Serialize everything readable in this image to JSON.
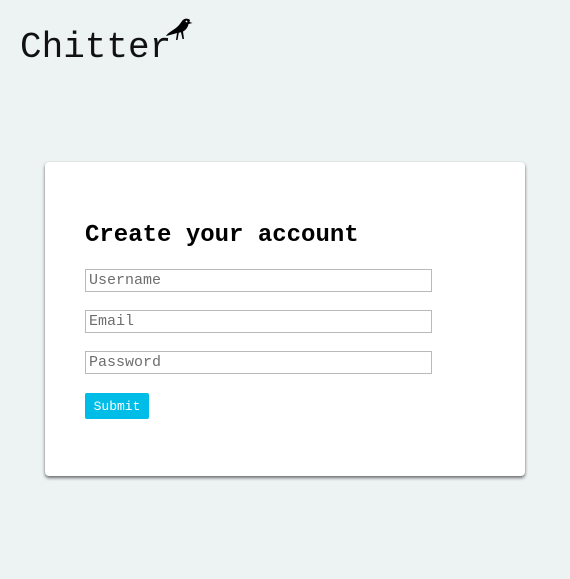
{
  "app": {
    "logo_text": "Chitter",
    "logo_icon": "bird-icon"
  },
  "signup": {
    "title": "Create your account",
    "username": {
      "placeholder": "Username",
      "value": ""
    },
    "email": {
      "placeholder": "Email",
      "value": ""
    },
    "password": {
      "placeholder": "Password",
      "value": ""
    },
    "submit_label": "Submit"
  },
  "colors": {
    "page_background": "#edf3f3",
    "card_background": "#ffffff",
    "accent": "#00bde8"
  }
}
